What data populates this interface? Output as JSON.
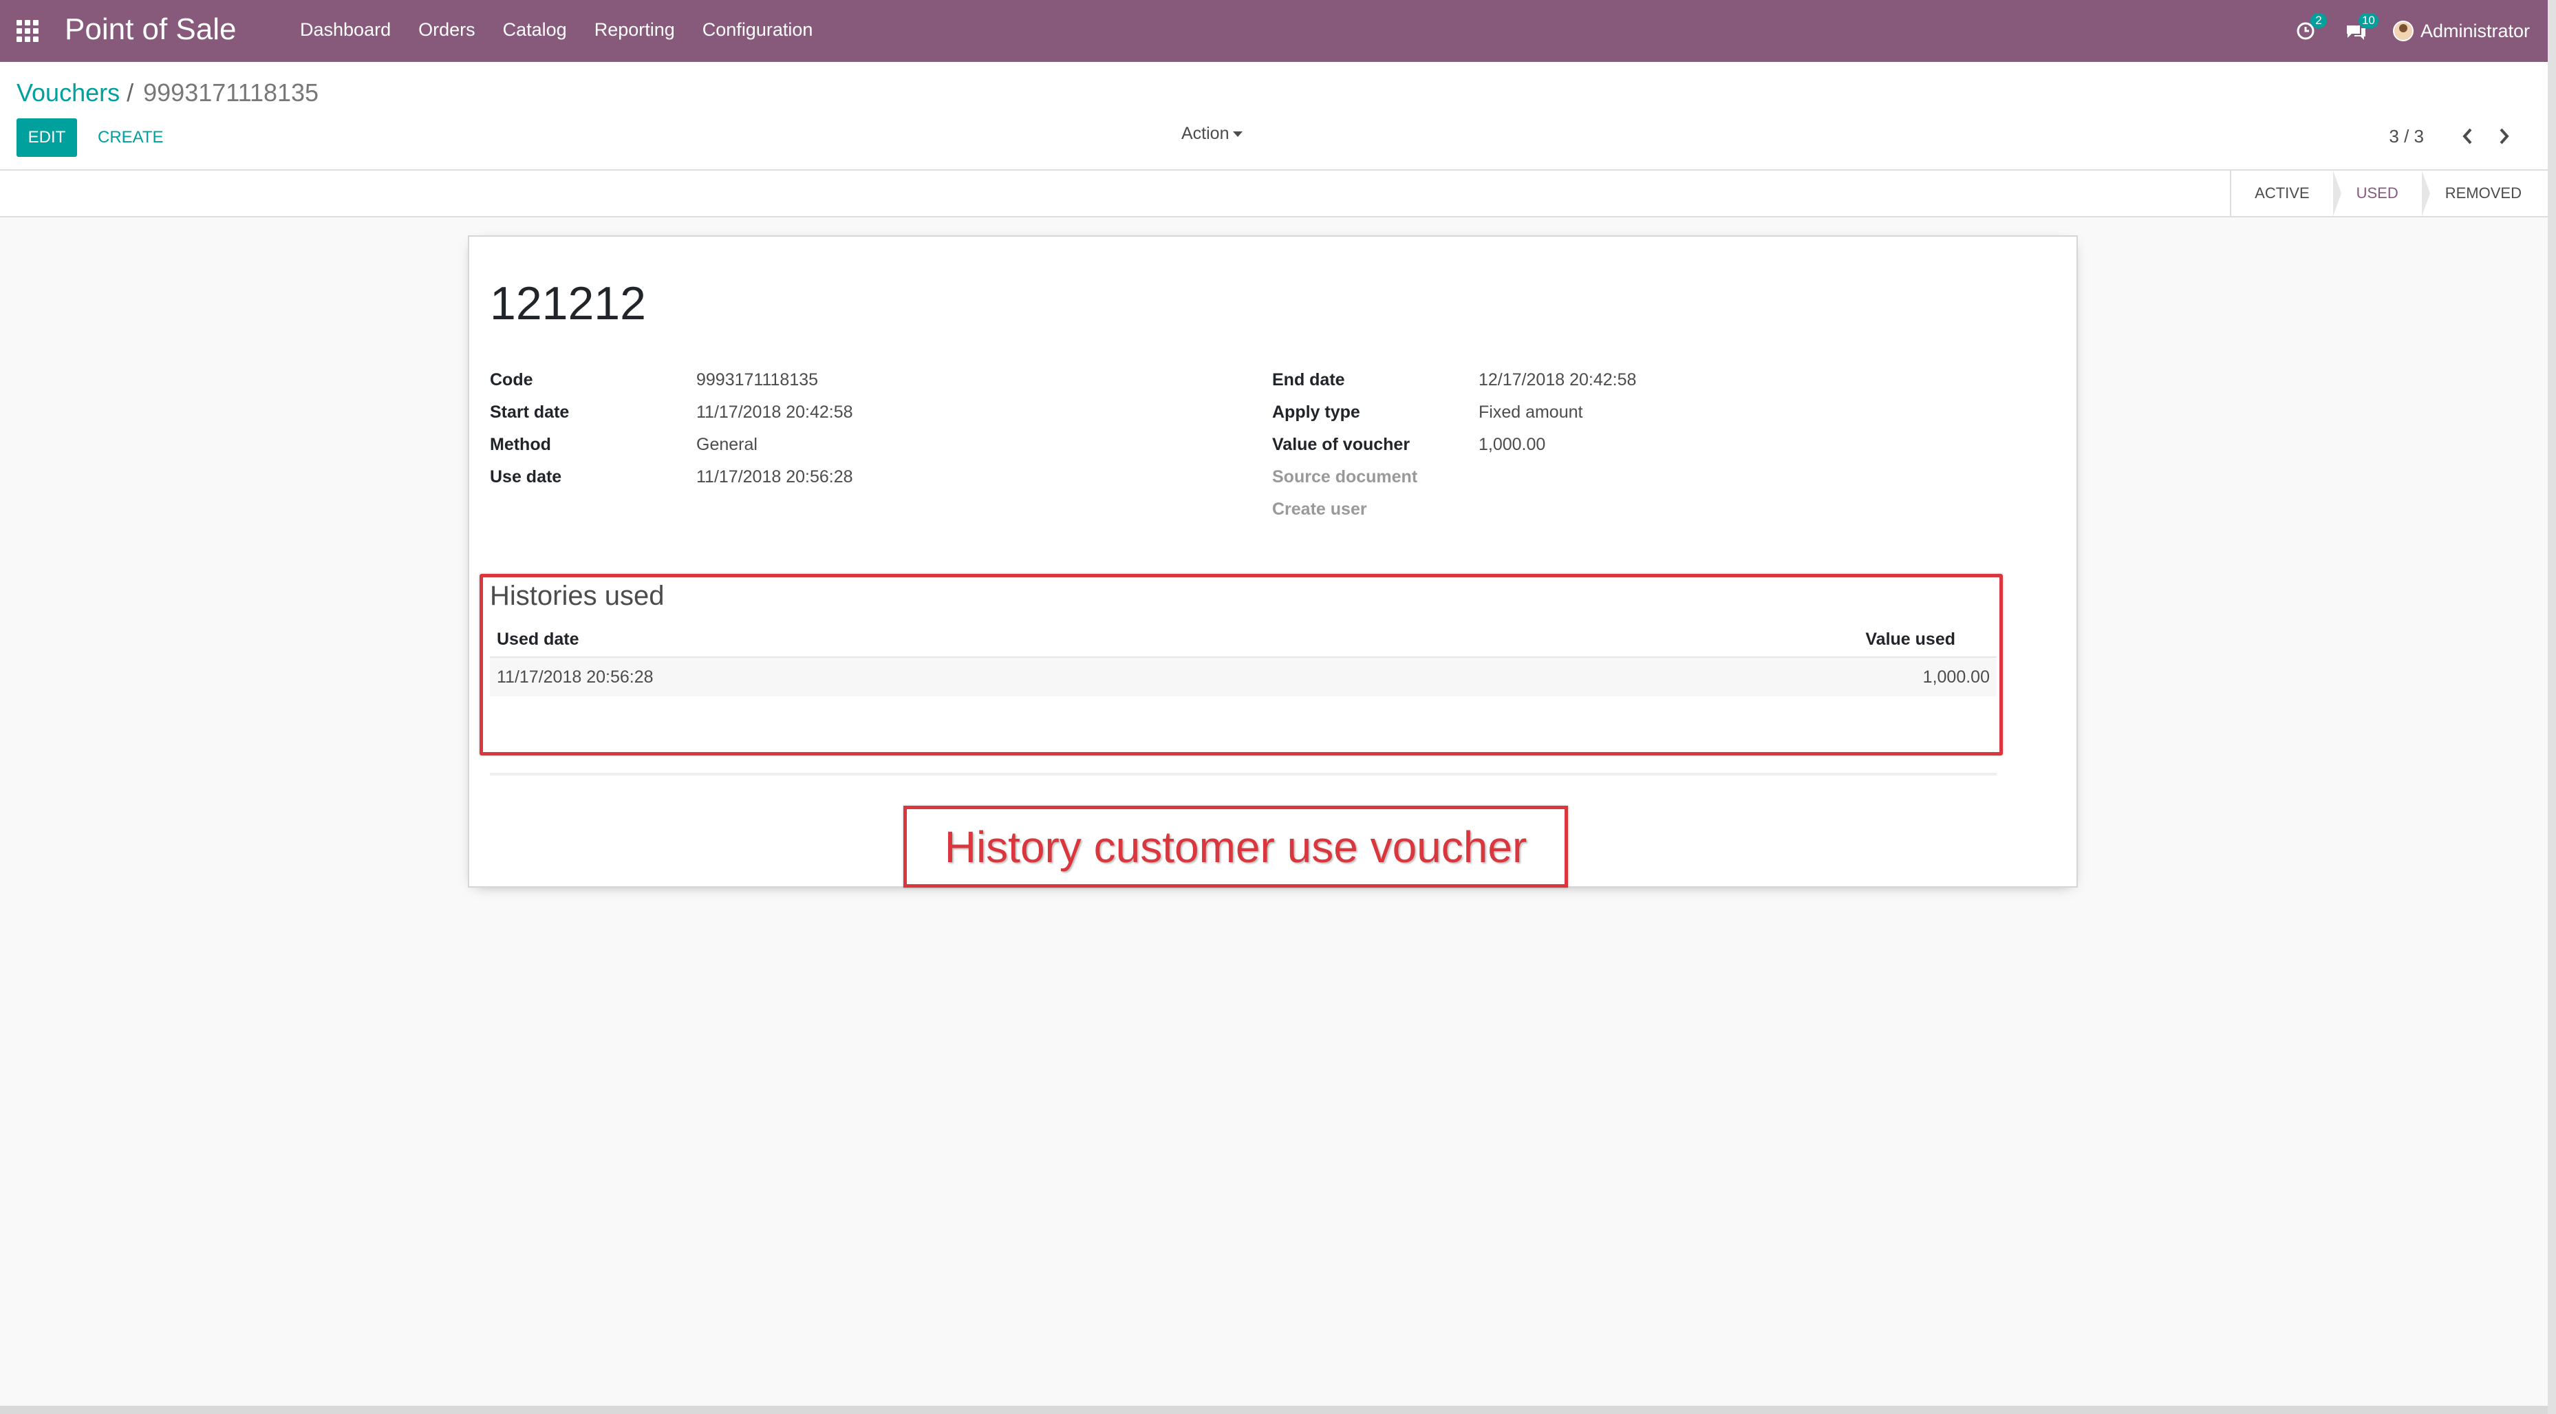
{
  "navbar": {
    "app_title": "Point of Sale",
    "menu": [
      "Dashboard",
      "Orders",
      "Catalog",
      "Reporting",
      "Configuration"
    ],
    "activity_badge": "2",
    "messages_badge": "10",
    "user": "Administrator",
    "bg_color": "#875a7b"
  },
  "breadcrumb": {
    "parent": "Vouchers",
    "separator": "/",
    "current": "9993171118135"
  },
  "control": {
    "edit_label": "EDIT",
    "create_label": "CREATE",
    "action_label": "Action",
    "pager": "3 / 3"
  },
  "statusbar": {
    "stages": [
      "ACTIVE",
      "USED",
      "REMOVED"
    ],
    "current_stage": "USED"
  },
  "record": {
    "title": "121212",
    "left_fields": [
      {
        "label": "Code",
        "value": "9993171118135"
      },
      {
        "label": "Start date",
        "value": "11/17/2018 20:42:58"
      },
      {
        "label": "Method",
        "value": "General"
      },
      {
        "label": "Use date",
        "value": "11/17/2018 20:56:28"
      }
    ],
    "right_fields": [
      {
        "label": "End date",
        "value": "12/17/2018 20:42:58"
      },
      {
        "label": "Apply type",
        "value": "Fixed amount"
      },
      {
        "label": "Value of voucher",
        "value": "1,000.00"
      },
      {
        "label": "Source document",
        "value": ""
      },
      {
        "label": "Create user",
        "value": ""
      }
    ]
  },
  "histories": {
    "title": "Histories used",
    "columns": [
      "Used date",
      "Value used"
    ],
    "rows": [
      {
        "used_date": "11/17/2018 20:56:28",
        "value_used": "1,000.00"
      }
    ]
  },
  "annotation": {
    "callout": "History customer use voucher",
    "color": "#d9363e"
  },
  "accent_color": "#00a09d"
}
